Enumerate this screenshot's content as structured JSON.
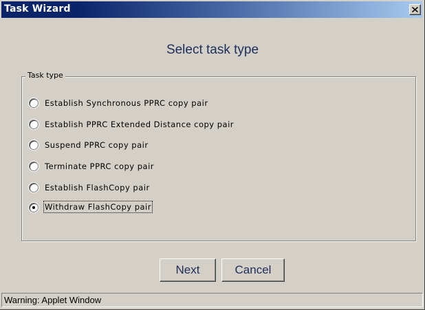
{
  "window": {
    "title": "Task Wizard",
    "close_icon": "close-x-icon"
  },
  "heading": "Select task type",
  "group": {
    "legend": "Task type",
    "options": [
      {
        "label": "Establish Synchronous PPRC copy pair",
        "selected": false
      },
      {
        "label": "Establish PPRC Extended Distance copy pair",
        "selected": false
      },
      {
        "label": "Suspend PPRC copy pair",
        "selected": false
      },
      {
        "label": "Terminate PPRC copy pair",
        "selected": false
      },
      {
        "label": "Establish FlashCopy pair",
        "selected": false
      },
      {
        "label": "Withdraw FlashCopy pair",
        "selected": true
      }
    ]
  },
  "buttons": {
    "next": "Next",
    "cancel": "Cancel"
  },
  "status": "Warning: Applet Window",
  "colors": {
    "titlebar_start": "#0a246a",
    "titlebar_end": "#a6caf0",
    "dialog_background": "#d4d0c8",
    "accent_text": "#1e2e5a"
  }
}
